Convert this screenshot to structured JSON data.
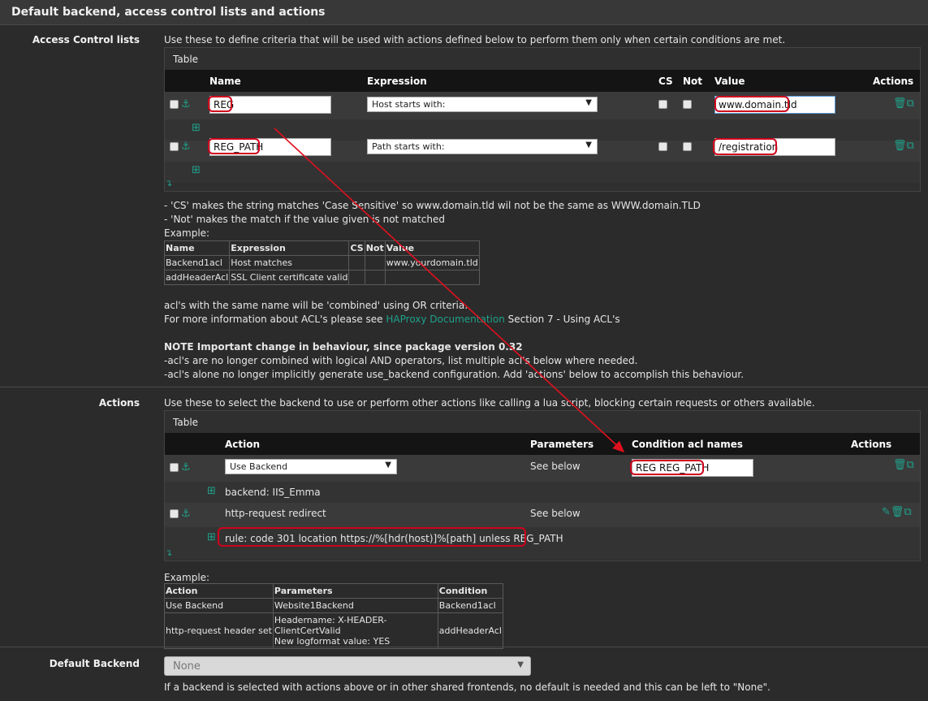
{
  "header": {
    "title": "Default backend, access control lists and actions"
  },
  "acl": {
    "label": "Access Control lists",
    "description": "Use these to define criteria that will be used with actions defined below to perform them only when certain conditions are met.",
    "table_title": "Table",
    "columns": [
      "Name",
      "Expression",
      "CS",
      "Not",
      "Value",
      "Actions"
    ],
    "rows": [
      {
        "name": "REG",
        "expression": "Host starts with:",
        "value": "www.domain.tld"
      },
      {
        "name": "REG_PATH",
        "expression": "Path starts with:",
        "value": "/registration"
      }
    ],
    "notes": [
      "- 'CS' makes the string matches 'Case Sensitive' so www.domain.tld wil not be the same as WWW.domain.TLD",
      "- 'Not' makes the match if the value given is not matched",
      "Example:"
    ],
    "example": {
      "headers": [
        "Name",
        "Expression",
        "CS",
        "Not",
        "Value"
      ],
      "rows": [
        [
          "Backend1acl",
          "Host matches",
          "",
          "",
          "www.yourdomain.tld"
        ],
        [
          "addHeaderAcl",
          "SSL Client certificate valid",
          "",
          "",
          ""
        ]
      ]
    },
    "combined_note": "acl's with the same name will be 'combined' using OR criteria.",
    "more_info_prefix": "For more information about ACL's please see",
    "more_info_link": "HAProxy Documentation",
    "more_info_suffix": "Section 7 - Using ACL's",
    "note_title": "NOTE Important change in behaviour, since package version 0.32",
    "note_lines": [
      "-acl's are no longer combined with logical AND operators, list multiple acl's below where needed.",
      "-acl's alone no longer implicitly generate use_backend configuration. Add 'actions' below to accomplish this behaviour."
    ]
  },
  "actions": {
    "label": "Actions",
    "description": "Use these to select the backend to use or perform other actions like calling a lua script, blocking certain requests or others available.",
    "table_title": "Table",
    "columns": [
      "Action",
      "Parameters",
      "Condition acl names",
      "Actions"
    ],
    "rows": [
      {
        "action": "Use Backend",
        "parameters": "See below",
        "condition": "REG REG_PATH",
        "detail": "backend: IIS_Emma"
      },
      {
        "action": "http-request redirect",
        "parameters": "See below",
        "condition": "",
        "detail": "rule: code 301 location https://%[hdr(host)]%[path] unless REG_PATH"
      }
    ],
    "example_label": "Example:",
    "example": {
      "headers": [
        "Action",
        "Parameters",
        "Condition"
      ],
      "rows": [
        [
          "Use Backend",
          "Website1Backend",
          "Backend1acl"
        ],
        [
          "http-request header set",
          "Headername: X-HEADER-ClientCertValid\nNew logformat value: YES",
          "addHeaderAcl"
        ]
      ]
    }
  },
  "default_backend": {
    "label": "Default Backend",
    "selected": "None",
    "help": "If a backend is selected with actions above or in other shared frontends, no default is needed and this can be left to \"None\"."
  }
}
